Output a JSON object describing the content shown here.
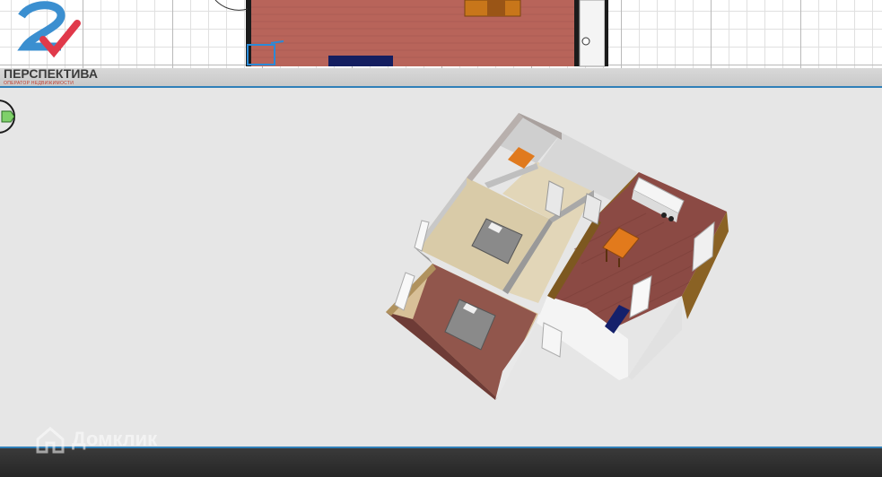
{
  "brand": {
    "name": "ПЕРСПЕКТИВА",
    "tagline": "ОПЕРАТОР НЕДВИЖИМОСТИ",
    "accent_blue": "#3b8fd0",
    "accent_red": "#e0394a"
  },
  "watermark": {
    "text": "Домклик"
  },
  "colors": {
    "divider_line": "#2f7fb8",
    "viewport_bg": "#e6e6e6",
    "floor_brick": "#8b4a44",
    "floor_wood": "#d8c7a5",
    "wall_wood": "#8a6224",
    "furniture_orange": "#e27a1c",
    "sofa_navy": "#14206b"
  },
  "icons": {
    "compass": "compass-icon",
    "watermark": "home-icon"
  }
}
